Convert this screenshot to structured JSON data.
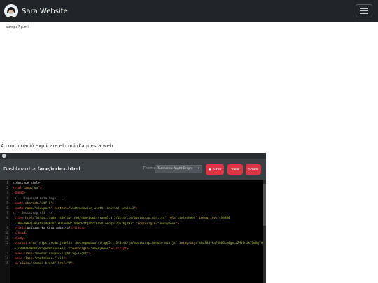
{
  "navbar": {
    "brand": "Sara Website"
  },
  "page": {
    "small_text": "apropa?.p.mi",
    "intro": "A continuació explicare el codi d'aquesta web"
  },
  "screenshot": {
    "breadcrumb_prefix": "Dashboard >",
    "breadcrumb_file": "face/index.html",
    "theme_label": "Theme",
    "theme_value": "Tomorrow Night Bright",
    "save_label": "Save",
    "view_label": "View",
    "share_label": "Share",
    "code_lines": [
      {
        "n": "1",
        "html": "<span class='code'>&lt;!doctype html&gt;</span>"
      },
      {
        "n": "2",
        "html": "<span class='t'>&lt;html</span> <span class='a'>lang=</span><span class='s'>\"en\"</span><span class='t'>&gt;</span>"
      },
      {
        "n": "3",
        "html": "  <span class='t'>&lt;head&gt;</span>"
      },
      {
        "n": "4",
        "html": "    <span class='c'>&lt;!-- Required meta tags --&gt;</span>"
      },
      {
        "n": "5",
        "html": "    <span class='t'>&lt;meta</span> <span class='a'>charset=</span><span class='s'>\"utf-8\"</span><span class='t'>&gt;</span>"
      },
      {
        "n": "6",
        "html": "    <span class='t'>&lt;meta</span> <span class='a'>name=</span><span class='s'>\"viewport\"</span> <span class='a'>content=</span><span class='s'>\"width=device-width, initial-scale=1\"</span><span class='t'>&gt;</span>"
      },
      {
        "n": "7",
        "html": "<span class='c'>&lt;!-- Bootstrap CSS --&gt;</span>"
      },
      {
        "n": "8",
        "html": "    <span class='t'>&lt;link</span> <span class='a'>href=</span><span class='s'>\"https://cdn.jsdelivr.net/npm/bootstrap@5.1.3/dist/css/bootstrap.min.css\"</span> <span class='a'>rel=</span><span class='s'>\"stylesheet\"</span> <span class='a'>integrity=</span><span class='s'>\"sha384</span>"
      },
      {
        "n": "",
        "html": "      <span class='s'>-1BmE4kWBq78iYhFldvKuhfTAU6auU8tT94WrHftjDbrCEXSU1oBoqyl2QvZ6jIW3\"</span> <span class='a'>crossorigin=</span><span class='s'>\"anonymous\"</span><span class='t'>&gt;</span>"
      },
      {
        "n": "9",
        "html": "    <span class='t'>&lt;title&gt;</span><span class='code'>Welcome to Sara website!</span><span class='t'>&lt;/title&gt;</span>"
      },
      {
        "n": "10",
        "html": "  <span class='t'>&lt;/head&gt;</span>"
      },
      {
        "n": "11",
        "html": "  <span class='t'>&lt;body&gt;</span>"
      },
      {
        "n": "12",
        "html": "    <span class='t'>&lt;script</span> <span class='a'>src=</span><span class='s'>\"https://cdn.jsdelivr.net/npm/bootstrap@5.1.3/dist/js/bootstrap.bundle.min.js\"</span> <span class='a'>integrity=</span><span class='s'>\"sha384-ka7Sk0Gln4gmtz2MlQnikT1wXgYsOg+OMhuP</span>"
      },
      {
        "n": "",
        "html": "      <span class='s'>+IlRH9sENBO0LRn5q+8nbTov4+1p\"</span> <span class='a'>crossorigin=</span><span class='s'>\"anonymous\"</span><span class='t'>&gt;&lt;/script&gt;</span>"
      },
      {
        "n": "13",
        "html": "    <span class='t'>&lt;nav</span> <span class='a'>class=</span><span class='s'>\"navbar navbar-light bg-light\"</span><span class='t'>&gt;</span>"
      },
      {
        "n": "14",
        "html": "      <span class='t'>&lt;div</span> <span class='a'>class=</span><span class='s'>\"container-fluid\"</span><span class='t'>&gt;</span>"
      },
      {
        "n": "15",
        "html": "        <span class='t'>&lt;a</span> <span class='a'>class=</span><span class='s'>\"navbar-brand\"</span> <span class='a'>href=</span><span class='s'>\"#\"</span><span class='t'>&gt;</span>"
      }
    ]
  }
}
